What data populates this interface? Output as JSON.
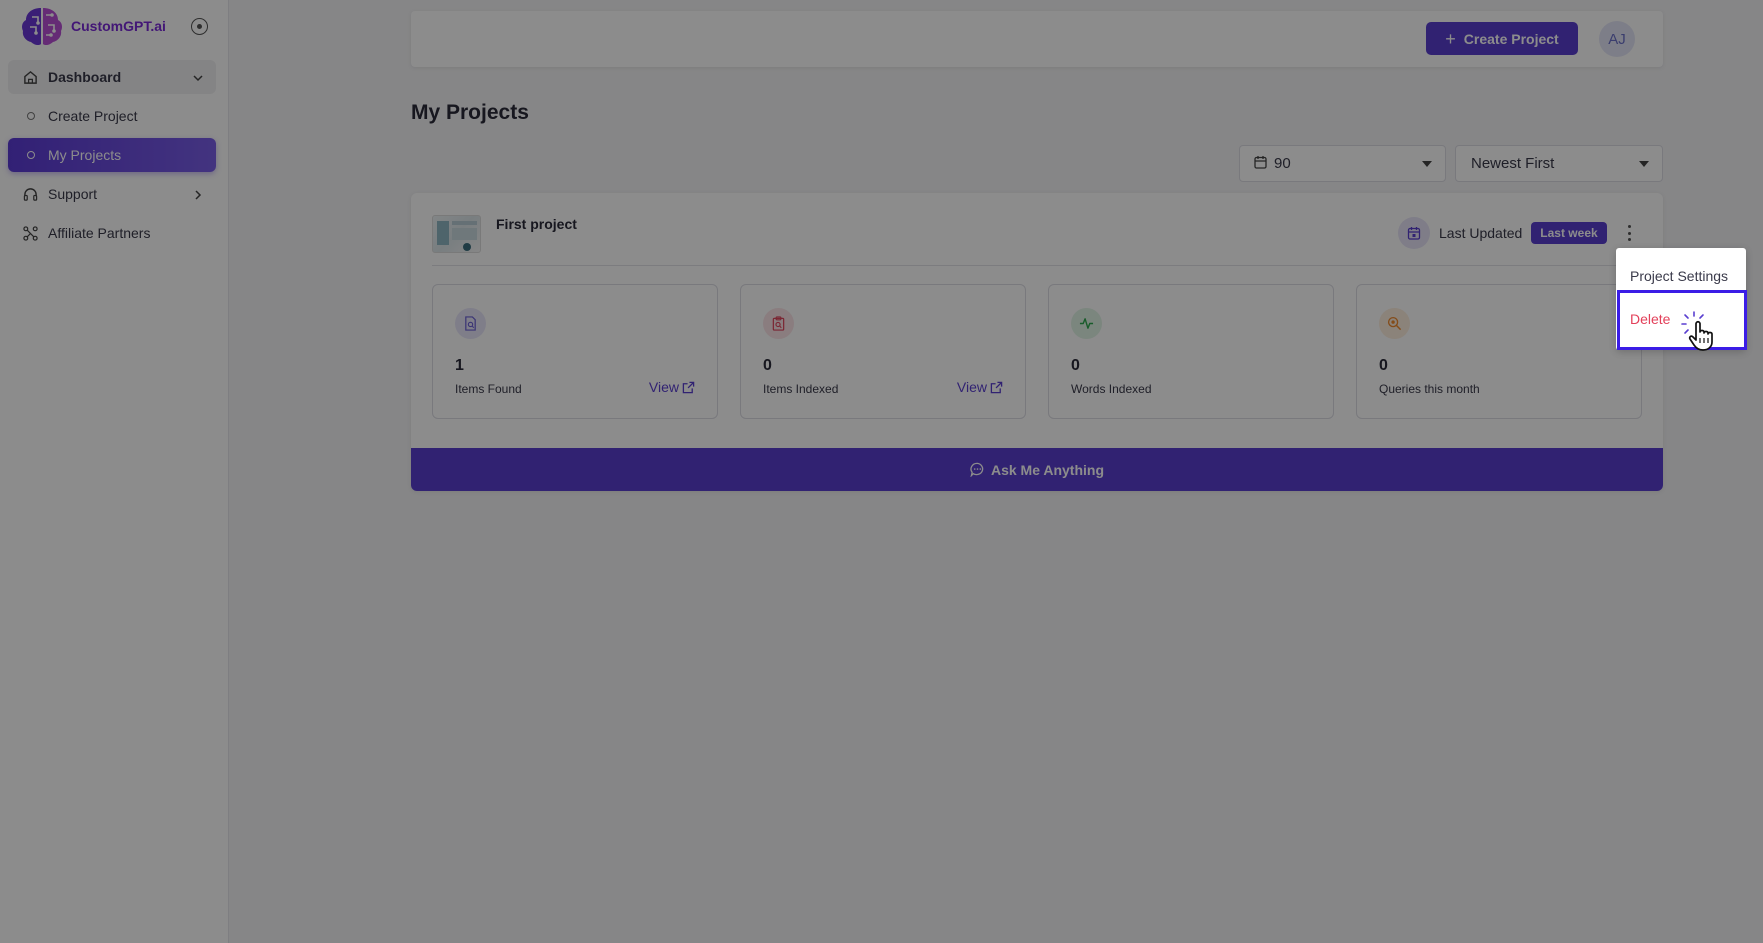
{
  "app": {
    "brand_name": "CustomGPT.ai",
    "brand_color": "#7a2bd8",
    "accent_color": "#5a3fd0"
  },
  "sidebar": {
    "collapse_icon": "circle-dot-icon",
    "items": [
      {
        "label": "Dashboard",
        "icon": "home-icon",
        "expanded": true
      },
      {
        "label": "Create Project",
        "icon": "bullet-icon",
        "active": false
      },
      {
        "label": "My Projects",
        "icon": "bullet-icon",
        "active": true
      },
      {
        "label": "Support",
        "icon": "headset-icon"
      },
      {
        "label": "Affiliate Partners",
        "icon": "network-icon"
      }
    ]
  },
  "header": {
    "create_button": "Create Project",
    "avatar_initials": "AJ"
  },
  "main": {
    "title": "My Projects",
    "filters": {
      "days_value": "90",
      "sort_value": "Newest First"
    },
    "project": {
      "name": "First project",
      "last_updated_label": "Last Updated",
      "last_updated_badge": "Last week",
      "stats": [
        {
          "value": "1",
          "label": "Items Found",
          "link": "View",
          "icon": "file-search-icon",
          "color": "#6b5fd6"
        },
        {
          "value": "0",
          "label": "Items Indexed",
          "link": "View",
          "icon": "clipboard-search-icon",
          "color": "#e0465e"
        },
        {
          "value": "0",
          "label": "Words Indexed",
          "link": "",
          "icon": "activity-icon",
          "color": "#2fa84f"
        },
        {
          "value": "0",
          "label": "Queries this month",
          "link": "",
          "icon": "zoom-icon",
          "color": "#f08a2e"
        }
      ],
      "ask_button": "Ask Me Anything"
    }
  },
  "dropdown": {
    "items": [
      {
        "label": "Project Settings"
      },
      {
        "label": "Delete",
        "color": "#e3405a"
      }
    ]
  }
}
